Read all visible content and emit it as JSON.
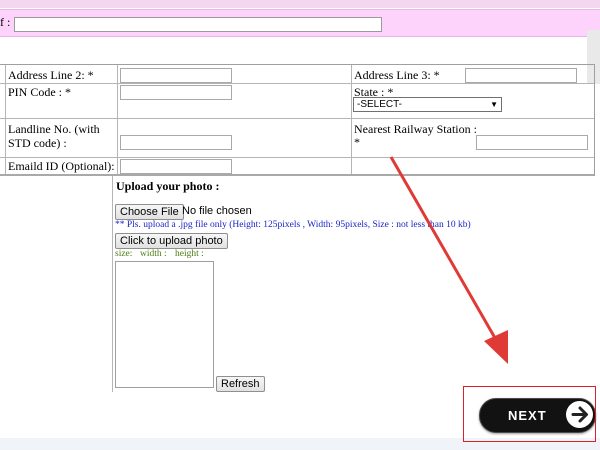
{
  "top_row": {
    "label": "f :",
    "value": ""
  },
  "address": {
    "line2_label": "Address Line 2: *",
    "line2_value": "",
    "line3_label": "Address Line 3: *",
    "line3_value": "",
    "pin_label": "PIN Code : *",
    "pin_value": "",
    "state_label": "State : *",
    "state_selected": "-SELECT-",
    "landline_label_1": "Landline No. (with",
    "landline_label_2": "STD code) :",
    "landline_value": "",
    "railway_label_1": "Nearest Railway Station :",
    "railway_label_2": "*",
    "railway_value": "",
    "email_label": "Emaild ID (Optional):",
    "email_value": ""
  },
  "upload": {
    "title": "Upload your photo :",
    "choose_file_label": "Choose File",
    "file_status": "No file chosen",
    "note": "** Pls. upload a .jpg file only (Height: 125pixels , Width: 95pixels, Size : not less than 10 kb)",
    "upload_button_label": "Click to upload photo",
    "size_label": "size:",
    "width_label": "width :",
    "height_label": "height :",
    "refresh_label": "Refresh"
  },
  "footer": {
    "next_label": "NEXT"
  },
  "colors": {
    "pink_row": "#fdd2fb",
    "annotation_red": "#e03a36",
    "next_bg": "#121212",
    "note_blue": "#1a24c8",
    "size_green": "#4a7d12"
  },
  "icons": [
    "dropdown-arrow-icon",
    "arrow-right-icon"
  ]
}
